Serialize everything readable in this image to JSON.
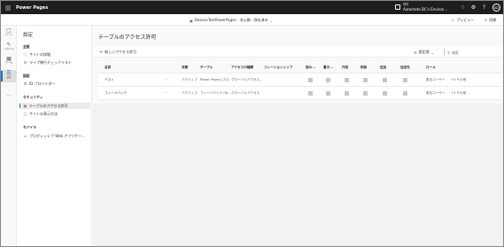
{
  "app": {
    "title": "Power Pages"
  },
  "environment": {
    "label": "環境",
    "name": "Automate DC's Environ..."
  },
  "topbar_icons": [
    "bell-icon",
    "gear-icon",
    "help-icon"
  ],
  "user": {
    "initials": "AD"
  },
  "site": {
    "crumb": "DeaconTestPowerPages - 非公開 - 保存済み"
  },
  "command": {
    "preview": "プレビュー",
    "sync": "同期"
  },
  "rail": [
    {
      "label": "ページ",
      "icon": "pages-icon"
    },
    {
      "label": "スタイル",
      "icon": "styling-icon"
    },
    {
      "label": "データ",
      "icon": "data-icon"
    },
    {
      "label": "設定",
      "icon": "settings-icon"
    }
  ],
  "sidepanel": {
    "title": "設定",
    "sections": [
      {
        "heading": "全般",
        "items": [
          "サイトの詳細",
          "ライブ移行チェックリスト"
        ]
      },
      {
        "heading": "認証",
        "items": [
          "ID プロバイダー"
        ]
      },
      {
        "heading": "セキュリティ",
        "items": [
          "テーブルのアクセス許可",
          "サイトの表示方法"
        ]
      },
      {
        "heading": "モバイル",
        "items": [
          "プログレッシブ Web アプリケー..."
        ]
      }
    ]
  },
  "main": {
    "title": "テーブルのアクセス許可",
    "new_label": "新しいアクセス許可",
    "filter_label": "既定値",
    "search_placeholder": "検索"
  },
  "table": {
    "headers": [
      "名前",
      "状態",
      "テーブル",
      "アクセスの種類",
      "リレーションシップ",
      "読み...",
      "書き...",
      "作成",
      "削除",
      "追加",
      "追加先",
      "ロール"
    ],
    "rows": [
      {
        "name": "テスト",
        "status": "アクティブ",
        "table": "Power Pages (プロ...",
        "access": "グローバルアクセス...",
        "relationship": "",
        "role": "匿名ユーザー",
        "role_more": "+3 その他"
      },
      {
        "name": "フィードバック",
        "status": "アクティブ",
        "table": "フィードバック (fe...",
        "access": "グローバルアクセス",
        "relationship": "",
        "role": "匿名ユーザー",
        "role_more": "+3 その他"
      }
    ]
  }
}
